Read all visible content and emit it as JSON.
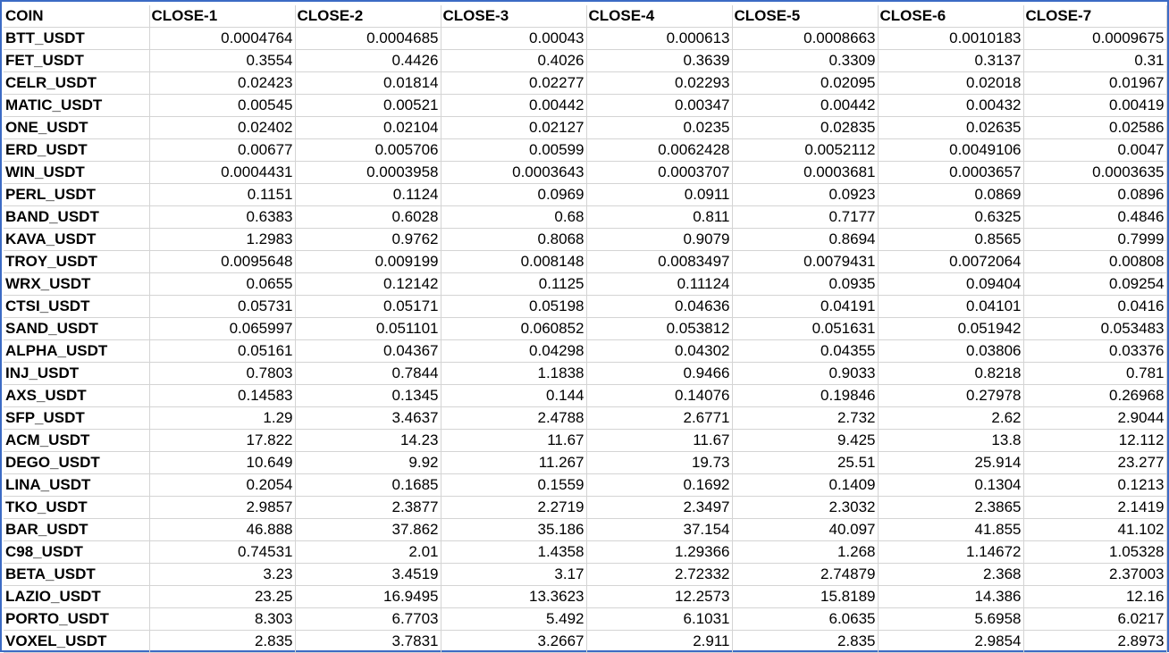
{
  "columns": [
    "COIN",
    "CLOSE-1",
    "CLOSE-2",
    "CLOSE-3",
    "CLOSE-4",
    "CLOSE-5",
    "CLOSE-6",
    "CLOSE-7"
  ],
  "rows": [
    [
      "BTT_USDT",
      "0.0004764",
      "0.0004685",
      "0.00043",
      "0.000613",
      "0.0008663",
      "0.0010183",
      "0.0009675"
    ],
    [
      "FET_USDT",
      "0.3554",
      "0.4426",
      "0.4026",
      "0.3639",
      "0.3309",
      "0.3137",
      "0.31"
    ],
    [
      "CELR_USDT",
      "0.02423",
      "0.01814",
      "0.02277",
      "0.02293",
      "0.02095",
      "0.02018",
      "0.01967"
    ],
    [
      "MATIC_USDT",
      "0.00545",
      "0.00521",
      "0.00442",
      "0.00347",
      "0.00442",
      "0.00432",
      "0.00419"
    ],
    [
      "ONE_USDT",
      "0.02402",
      "0.02104",
      "0.02127",
      "0.0235",
      "0.02835",
      "0.02635",
      "0.02586"
    ],
    [
      "ERD_USDT",
      "0.00677",
      "0.005706",
      "0.00599",
      "0.0062428",
      "0.0052112",
      "0.0049106",
      "0.0047"
    ],
    [
      "WIN_USDT",
      "0.0004431",
      "0.0003958",
      "0.0003643",
      "0.0003707",
      "0.0003681",
      "0.0003657",
      "0.0003635"
    ],
    [
      "PERL_USDT",
      "0.1151",
      "0.1124",
      "0.0969",
      "0.0911",
      "0.0923",
      "0.0869",
      "0.0896"
    ],
    [
      "BAND_USDT",
      "0.6383",
      "0.6028",
      "0.68",
      "0.811",
      "0.7177",
      "0.6325",
      "0.4846"
    ],
    [
      "KAVA_USDT",
      "1.2983",
      "0.9762",
      "0.8068",
      "0.9079",
      "0.8694",
      "0.8565",
      "0.7999"
    ],
    [
      "TROY_USDT",
      "0.0095648",
      "0.009199",
      "0.008148",
      "0.0083497",
      "0.0079431",
      "0.0072064",
      "0.00808"
    ],
    [
      "WRX_USDT",
      "0.0655",
      "0.12142",
      "0.1125",
      "0.11124",
      "0.0935",
      "0.09404",
      "0.09254"
    ],
    [
      "CTSI_USDT",
      "0.05731",
      "0.05171",
      "0.05198",
      "0.04636",
      "0.04191",
      "0.04101",
      "0.0416"
    ],
    [
      "SAND_USDT",
      "0.065997",
      "0.051101",
      "0.060852",
      "0.053812",
      "0.051631",
      "0.051942",
      "0.053483"
    ],
    [
      "ALPHA_USDT",
      "0.05161",
      "0.04367",
      "0.04298",
      "0.04302",
      "0.04355",
      "0.03806",
      "0.03376"
    ],
    [
      "INJ_USDT",
      "0.7803",
      "0.7844",
      "1.1838",
      "0.9466",
      "0.9033",
      "0.8218",
      "0.781"
    ],
    [
      "AXS_USDT",
      "0.14583",
      "0.1345",
      "0.144",
      "0.14076",
      "0.19846",
      "0.27978",
      "0.26968"
    ],
    [
      "SFP_USDT",
      "1.29",
      "3.4637",
      "2.4788",
      "2.6771",
      "2.732",
      "2.62",
      "2.9044"
    ],
    [
      "ACM_USDT",
      "17.822",
      "14.23",
      "11.67",
      "11.67",
      "9.425",
      "13.8",
      "12.112"
    ],
    [
      "DEGO_USDT",
      "10.649",
      "9.92",
      "11.267",
      "19.73",
      "25.51",
      "25.914",
      "23.277"
    ],
    [
      "LINA_USDT",
      "0.2054",
      "0.1685",
      "0.1559",
      "0.1692",
      "0.1409",
      "0.1304",
      "0.1213"
    ],
    [
      "TKO_USDT",
      "2.9857",
      "2.3877",
      "2.2719",
      "2.3497",
      "2.3032",
      "2.3865",
      "2.1419"
    ],
    [
      "BAR_USDT",
      "46.888",
      "37.862",
      "35.186",
      "37.154",
      "40.097",
      "41.855",
      "41.102"
    ],
    [
      "C98_USDT",
      "0.74531",
      "2.01",
      "1.4358",
      "1.29366",
      "1.268",
      "1.14672",
      "1.05328"
    ],
    [
      "BETA_USDT",
      "3.23",
      "3.4519",
      "3.17",
      "2.72332",
      "2.74879",
      "2.368",
      "2.37003"
    ],
    [
      "LAZIO_USDT",
      "23.25",
      "16.9495",
      "13.3623",
      "12.2573",
      "15.8189",
      "14.386",
      "12.16"
    ],
    [
      "PORTO_USDT",
      "8.303",
      "6.7703",
      "5.492",
      "6.1031",
      "6.0635",
      "5.6958",
      "6.0217"
    ],
    [
      "VOXEL_USDT",
      "2.835",
      "3.7831",
      "3.2667",
      "2.911",
      "2.835",
      "2.9854",
      "2.8973"
    ]
  ]
}
